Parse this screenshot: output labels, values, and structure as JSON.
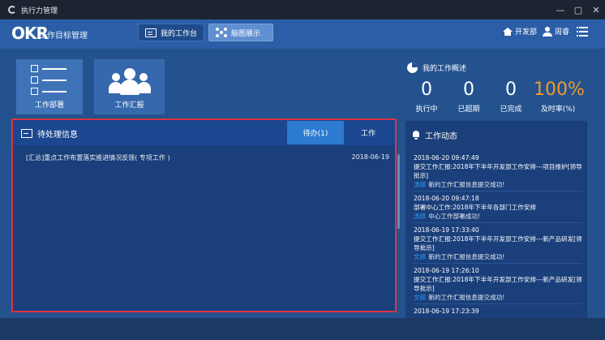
{
  "window": {
    "title": "执行力管理",
    "minimize": "—",
    "maximize": "▢",
    "close": "✕"
  },
  "header": {
    "logo": "OKR",
    "subtitle": "工作目标管理",
    "nav": [
      {
        "label": "我的工作台"
      },
      {
        "label": "脑图展示"
      }
    ],
    "dept": "开发部",
    "user": "周睿"
  },
  "tiles": [
    {
      "label": "工作部署"
    },
    {
      "label": "工作汇报"
    }
  ],
  "overview": {
    "title": "我的工作概述",
    "stats": [
      {
        "value": "0",
        "label": "执行中"
      },
      {
        "value": "0",
        "label": "已超期"
      },
      {
        "value": "0",
        "label": "已完成"
      },
      {
        "value": "100%",
        "label": "及时率(%)"
      }
    ],
    "accent": "#f39a2a"
  },
  "pending": {
    "title": "待处理信息",
    "tabs": [
      {
        "label": "待办(1)"
      },
      {
        "label": "工作"
      }
    ],
    "rows": [
      {
        "text": "[汇总]重点工作布置落实推进情况反馈( 专项工作 )",
        "date": "2018-06-19"
      }
    ]
  },
  "activity": {
    "title": "工作动态",
    "items": [
      {
        "time": "2018-06-20 09:47:49",
        "text": "提交工作汇报:2018年下半年开发部工作安排---项目维护[领导批示]",
        "who": "涛郎",
        "msg": "新的工作汇报信息提交成功!"
      },
      {
        "time": "2018-06-20 09:47:18",
        "text": "部署中心工作:2018年下半年各部门工作安排",
        "who": "涛郎",
        "msg": "中心工作部署成功!"
      },
      {
        "time": "2018-06-19 17:33:40",
        "text": "提交工作汇报:2018年下半年开发部工作安排---新产品研发[领导批示]",
        "who": "文郎",
        "msg": "新的工作汇报信息提交成功!"
      },
      {
        "time": "2018-06-19 17:26:10",
        "text": "提交工作汇报:2018年下半年开发部工作安排---新产品研发[领导批示]",
        "who": "文郎",
        "msg": "新的工作汇报信息提交成功!"
      },
      {
        "time": "2018-06-19 17:23:39",
        "text": "",
        "who": "",
        "msg": ""
      }
    ]
  },
  "colors": {
    "header": "#2b5ea6",
    "panel": "#1a3f7a",
    "active_tab": "#2c7ad1",
    "highlight_border": "#d9353f",
    "user_name": "#2d9bf0"
  }
}
